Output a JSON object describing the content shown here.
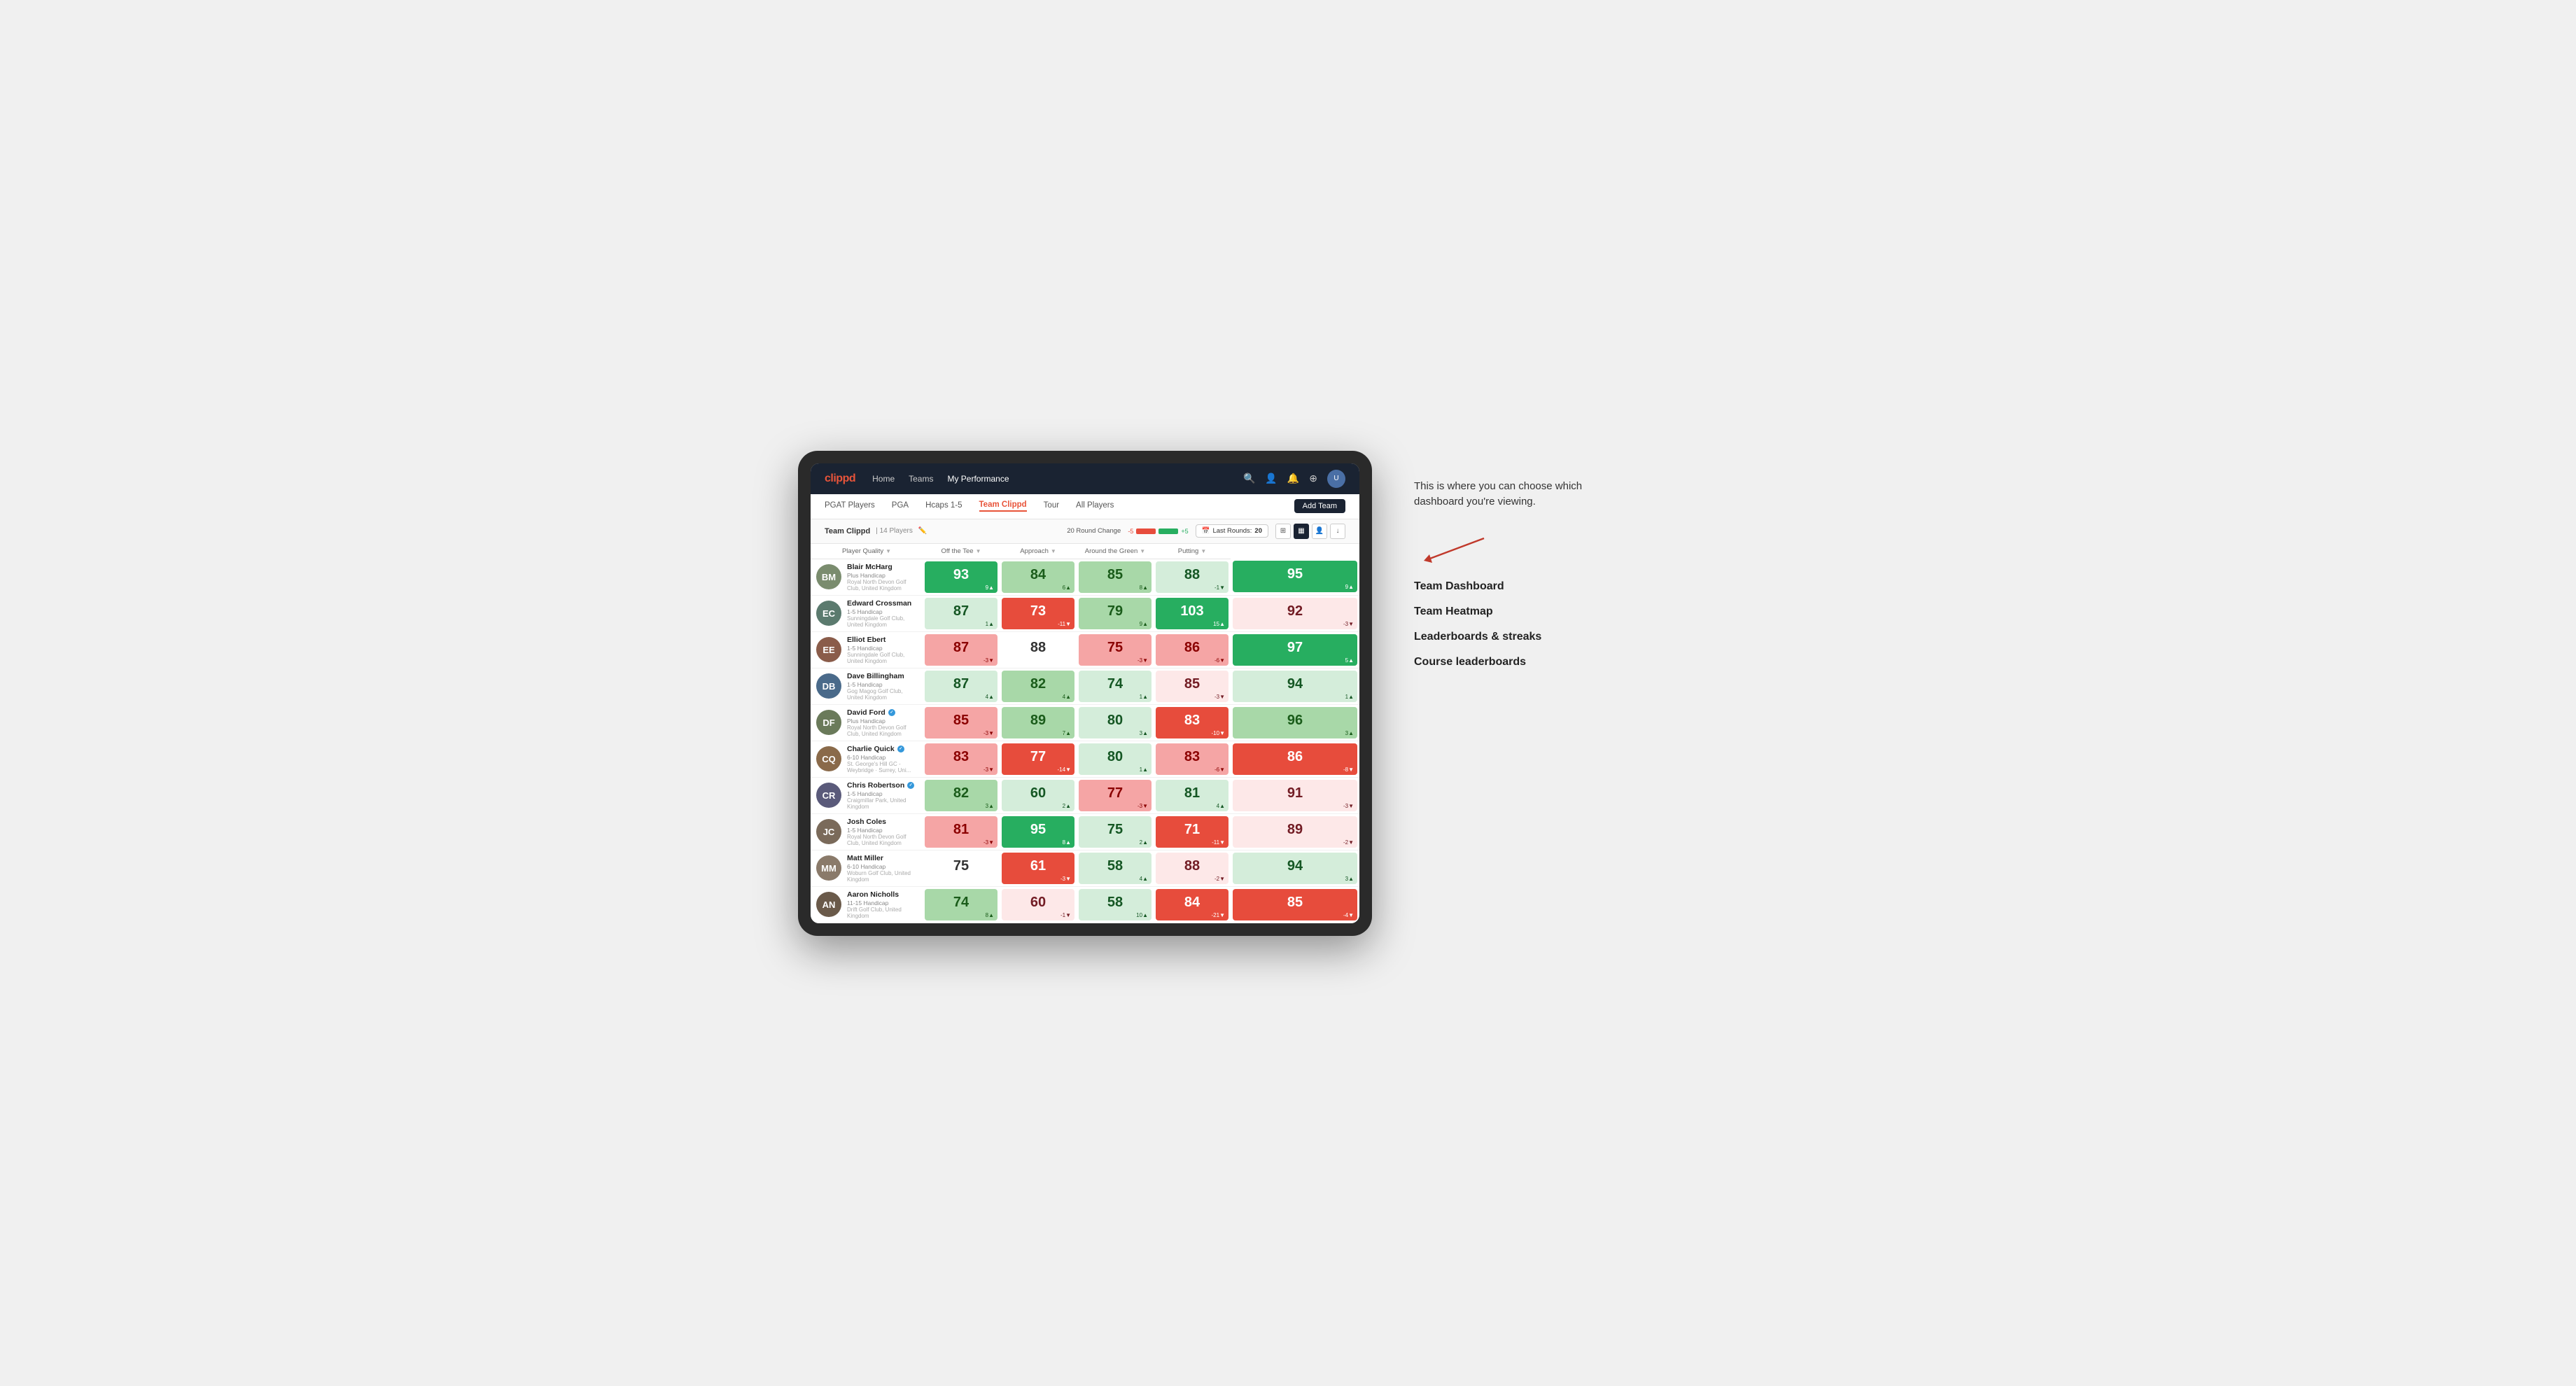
{
  "annotation": {
    "intro_text": "This is where you can choose which dashboard you're viewing.",
    "dashboard_items": [
      "Team Dashboard",
      "Team Heatmap",
      "Leaderboards & streaks",
      "Course leaderboards"
    ]
  },
  "nav": {
    "logo": "clippd",
    "items": [
      {
        "label": "Home",
        "active": false
      },
      {
        "label": "Teams",
        "active": false
      },
      {
        "label": "My Performance",
        "active": true
      }
    ],
    "right_icons": [
      "🔍",
      "👤",
      "🔔",
      "⊕"
    ]
  },
  "sub_nav": {
    "items": [
      {
        "label": "PGAT Players",
        "active": false
      },
      {
        "label": "PGA",
        "active": false
      },
      {
        "label": "Hcaps 1-5",
        "active": false
      },
      {
        "label": "Team Clippd",
        "active": true
      },
      {
        "label": "Tour",
        "active": false
      },
      {
        "label": "All Players",
        "active": false
      }
    ],
    "add_team_label": "Add Team"
  },
  "team_header": {
    "title": "Team Clippd",
    "separator": "|",
    "count": "14 Players",
    "round_change_label": "20 Round Change",
    "change_neg": "-5",
    "change_pos": "+5",
    "last_rounds_label": "Last Rounds:",
    "last_rounds_value": "20"
  },
  "table": {
    "columns": [
      {
        "label": "Player Quality",
        "sortable": true
      },
      {
        "label": "Off the Tee",
        "sortable": true
      },
      {
        "label": "Approach",
        "sortable": true
      },
      {
        "label": "Around the Green",
        "sortable": true
      },
      {
        "label": "Putting",
        "sortable": true
      }
    ],
    "players": [
      {
        "name": "Blair McHarg",
        "handicap": "Plus Handicap",
        "club": "Royal North Devon Golf Club, United Kingdom",
        "avatar_color": "#7a8c6e",
        "initials": "BM",
        "scores": [
          {
            "value": "93",
            "change": "9▲",
            "color": "green-dark"
          },
          {
            "value": "84",
            "change": "6▲",
            "color": "green-light"
          },
          {
            "value": "85",
            "change": "8▲",
            "color": "green-light"
          },
          {
            "value": "88",
            "change": "-1▼",
            "color": "very-light-green"
          },
          {
            "value": "95",
            "change": "9▲",
            "color": "green-dark"
          }
        ]
      },
      {
        "name": "Edward Crossman",
        "handicap": "1-5 Handicap",
        "club": "Sunningdale Golf Club, United Kingdom",
        "avatar_color": "#5b7a6e",
        "initials": "EC",
        "scores": [
          {
            "value": "87",
            "change": "1▲",
            "color": "very-light-green"
          },
          {
            "value": "73",
            "change": "-11▼",
            "color": "red-dark"
          },
          {
            "value": "79",
            "change": "9▲",
            "color": "green-light"
          },
          {
            "value": "103",
            "change": "15▲",
            "color": "green-dark"
          },
          {
            "value": "92",
            "change": "-3▼",
            "color": "very-light-red"
          }
        ]
      },
      {
        "name": "Elliot Ebert",
        "handicap": "1-5 Handicap",
        "club": "Sunningdale Golf Club, United Kingdom",
        "avatar_color": "#8a5c4a",
        "initials": "EE",
        "scores": [
          {
            "value": "87",
            "change": "-3▼",
            "color": "red-light"
          },
          {
            "value": "88",
            "change": "",
            "color": "neutral"
          },
          {
            "value": "75",
            "change": "-3▼",
            "color": "red-light"
          },
          {
            "value": "86",
            "change": "-6▼",
            "color": "red-light"
          },
          {
            "value": "97",
            "change": "5▲",
            "color": "green-dark"
          }
        ]
      },
      {
        "name": "Dave Billingham",
        "handicap": "1-5 Handicap",
        "club": "Gog Magog Golf Club, United Kingdom",
        "avatar_color": "#4a6a8a",
        "initials": "DB",
        "scores": [
          {
            "value": "87",
            "change": "4▲",
            "color": "very-light-green"
          },
          {
            "value": "82",
            "change": "4▲",
            "color": "green-light"
          },
          {
            "value": "74",
            "change": "1▲",
            "color": "very-light-green"
          },
          {
            "value": "85",
            "change": "-3▼",
            "color": "very-light-red"
          },
          {
            "value": "94",
            "change": "1▲",
            "color": "very-light-green"
          }
        ]
      },
      {
        "name": "David Ford",
        "handicap": "Plus Handicap",
        "club": "Royal North Devon Golf Club, United Kingdom",
        "avatar_color": "#6a7a5a",
        "initials": "DF",
        "verified": true,
        "scores": [
          {
            "value": "85",
            "change": "-3▼",
            "color": "red-light"
          },
          {
            "value": "89",
            "change": "7▲",
            "color": "green-light"
          },
          {
            "value": "80",
            "change": "3▲",
            "color": "very-light-green"
          },
          {
            "value": "83",
            "change": "-10▼",
            "color": "red-dark"
          },
          {
            "value": "96",
            "change": "3▲",
            "color": "green-light"
          }
        ]
      },
      {
        "name": "Charlie Quick",
        "handicap": "6-10 Handicap",
        "club": "St. George's Hill GC - Weybridge · Surrey, Uni...",
        "avatar_color": "#8a6a4a",
        "initials": "CQ",
        "verified": true,
        "scores": [
          {
            "value": "83",
            "change": "-3▼",
            "color": "red-light"
          },
          {
            "value": "77",
            "change": "-14▼",
            "color": "red-dark"
          },
          {
            "value": "80",
            "change": "1▲",
            "color": "very-light-green"
          },
          {
            "value": "83",
            "change": "-6▼",
            "color": "red-light"
          },
          {
            "value": "86",
            "change": "-8▼",
            "color": "red-dark"
          }
        ]
      },
      {
        "name": "Chris Robertson",
        "handicap": "1-5 Handicap",
        "club": "Craigmillar Park, United Kingdom",
        "avatar_color": "#5a5a7a",
        "initials": "CR",
        "verified": true,
        "scores": [
          {
            "value": "82",
            "change": "3▲",
            "color": "green-light"
          },
          {
            "value": "60",
            "change": "2▲",
            "color": "very-light-green"
          },
          {
            "value": "77",
            "change": "-3▼",
            "color": "red-light"
          },
          {
            "value": "81",
            "change": "4▲",
            "color": "very-light-green"
          },
          {
            "value": "91",
            "change": "-3▼",
            "color": "very-light-red"
          }
        ]
      },
      {
        "name": "Josh Coles",
        "handicap": "1-5 Handicap",
        "club": "Royal North Devon Golf Club, United Kingdom",
        "avatar_color": "#7a6a5a",
        "initials": "JC",
        "scores": [
          {
            "value": "81",
            "change": "-3▼",
            "color": "red-light"
          },
          {
            "value": "95",
            "change": "8▲",
            "color": "green-dark"
          },
          {
            "value": "75",
            "change": "2▲",
            "color": "very-light-green"
          },
          {
            "value": "71",
            "change": "-11▼",
            "color": "red-dark"
          },
          {
            "value": "89",
            "change": "-2▼",
            "color": "very-light-red"
          }
        ]
      },
      {
        "name": "Matt Miller",
        "handicap": "6-10 Handicap",
        "club": "Woburn Golf Club, United Kingdom",
        "avatar_color": "#8a7a6a",
        "initials": "MM",
        "scores": [
          {
            "value": "75",
            "change": "",
            "color": "neutral"
          },
          {
            "value": "61",
            "change": "-3▼",
            "color": "red-dark"
          },
          {
            "value": "58",
            "change": "4▲",
            "color": "very-light-green"
          },
          {
            "value": "88",
            "change": "-2▼",
            "color": "very-light-red"
          },
          {
            "value": "94",
            "change": "3▲",
            "color": "very-light-green"
          }
        ]
      },
      {
        "name": "Aaron Nicholls",
        "handicap": "11-15 Handicap",
        "club": "Drift Golf Club, United Kingdom",
        "avatar_color": "#6a5a4a",
        "initials": "AN",
        "scores": [
          {
            "value": "74",
            "change": "8▲",
            "color": "green-light"
          },
          {
            "value": "60",
            "change": "-1▼",
            "color": "very-light-red"
          },
          {
            "value": "58",
            "change": "10▲",
            "color": "very-light-green"
          },
          {
            "value": "84",
            "change": "-21▼",
            "color": "red-dark"
          },
          {
            "value": "85",
            "change": "-4▼",
            "color": "red-dark"
          }
        ]
      }
    ]
  }
}
